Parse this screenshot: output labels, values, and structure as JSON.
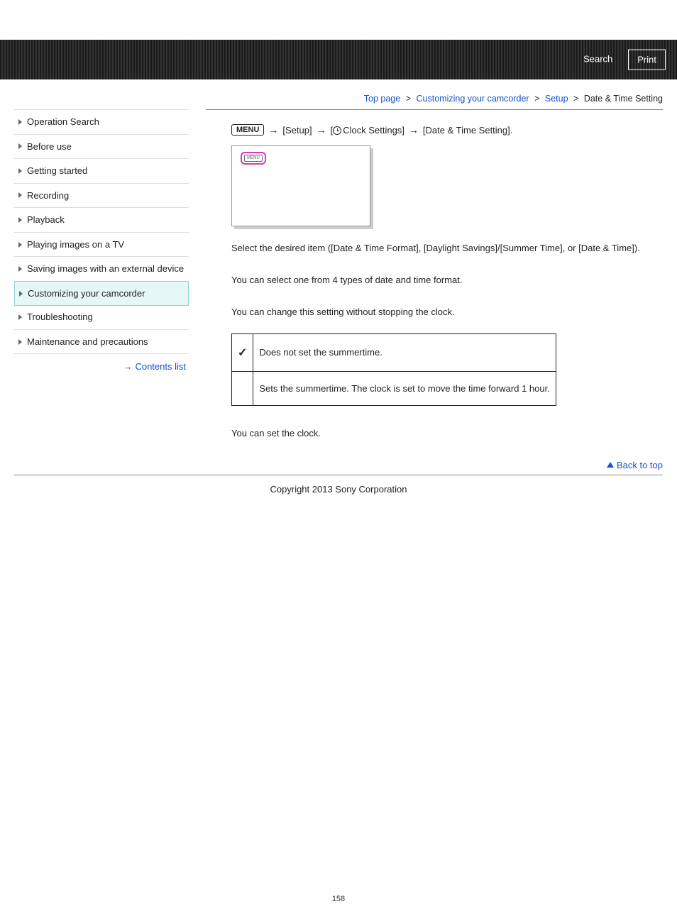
{
  "topbar": {
    "search": "Search",
    "print": "Print"
  },
  "breadcrumb": {
    "items": [
      "Top page",
      "Customizing your camcorder",
      "Setup"
    ],
    "last": "Date & Time Setting"
  },
  "sidebar": {
    "items": [
      "Operation Search",
      "Before use",
      "Getting started",
      "Recording",
      "Playback",
      "Playing images on a TV",
      "Saving images with an external device",
      "Customizing your camcorder",
      "Troubleshooting",
      "Maintenance and precautions"
    ],
    "activeIndex": 7,
    "contents_link": "Contents list"
  },
  "menu_badge": "MENU",
  "instr": {
    "setup": "[Setup]",
    "clock_prefix": "[",
    "clock_label": "Clock Settings]",
    "target": "[Date & Time Setting]."
  },
  "mini_label": "MENU",
  "body": {
    "select_desired": "Select the desired item ([Date & Time Format], [Daylight Savings]/[Summer Time], or [Date & Time]).",
    "format_note": "You can select one from 4 types of date and time format.",
    "summer_intro": "You can change this setting without stopping the clock.",
    "table": {
      "off": "Does not set the summertime.",
      "on": "Sets the summertime. The clock is set to move the time forward 1 hour."
    },
    "clock_note": "You can set the clock."
  },
  "backtop": "Back to top",
  "copyright": "Copyright 2013 Sony Corporation",
  "page_number": "158"
}
